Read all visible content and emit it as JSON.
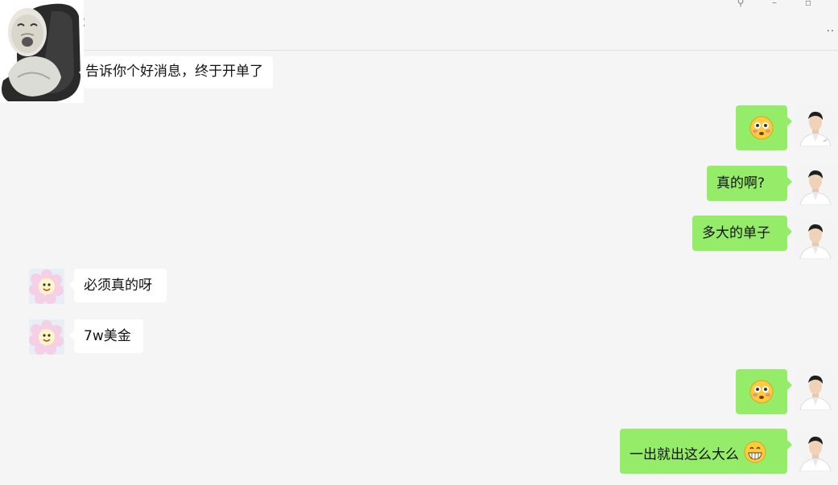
{
  "window": {
    "title_colon": ":",
    "controls": {
      "pin_icon": "pin-icon",
      "minimize_icon": "minimize-icon",
      "maximize_icon": "maximize-icon"
    },
    "more_dots": ".."
  },
  "colors": {
    "background": "#f5f5f5",
    "self_bubble": "#95ec69",
    "other_bubble": "#ffffff"
  },
  "messages": [
    {
      "side": "left",
      "sender": "sticker-avatar",
      "text": "告诉你个好消息，终于开单了"
    },
    {
      "side": "right",
      "sender": "self",
      "emoji": "flushed-face-emoji"
    },
    {
      "side": "right",
      "sender": "self",
      "text": "真的啊?"
    },
    {
      "side": "right",
      "sender": "self",
      "text": "多大的单子"
    },
    {
      "side": "left",
      "sender": "flower-avatar",
      "text": "必须真的呀"
    },
    {
      "side": "left",
      "sender": "flower-avatar",
      "text": "7w美金"
    },
    {
      "side": "right",
      "sender": "self",
      "emoji": "flushed-face-emoji"
    },
    {
      "side": "right",
      "sender": "self",
      "text": "一出就出这么大么",
      "emoji": "grinning-face-emoji"
    }
  ]
}
